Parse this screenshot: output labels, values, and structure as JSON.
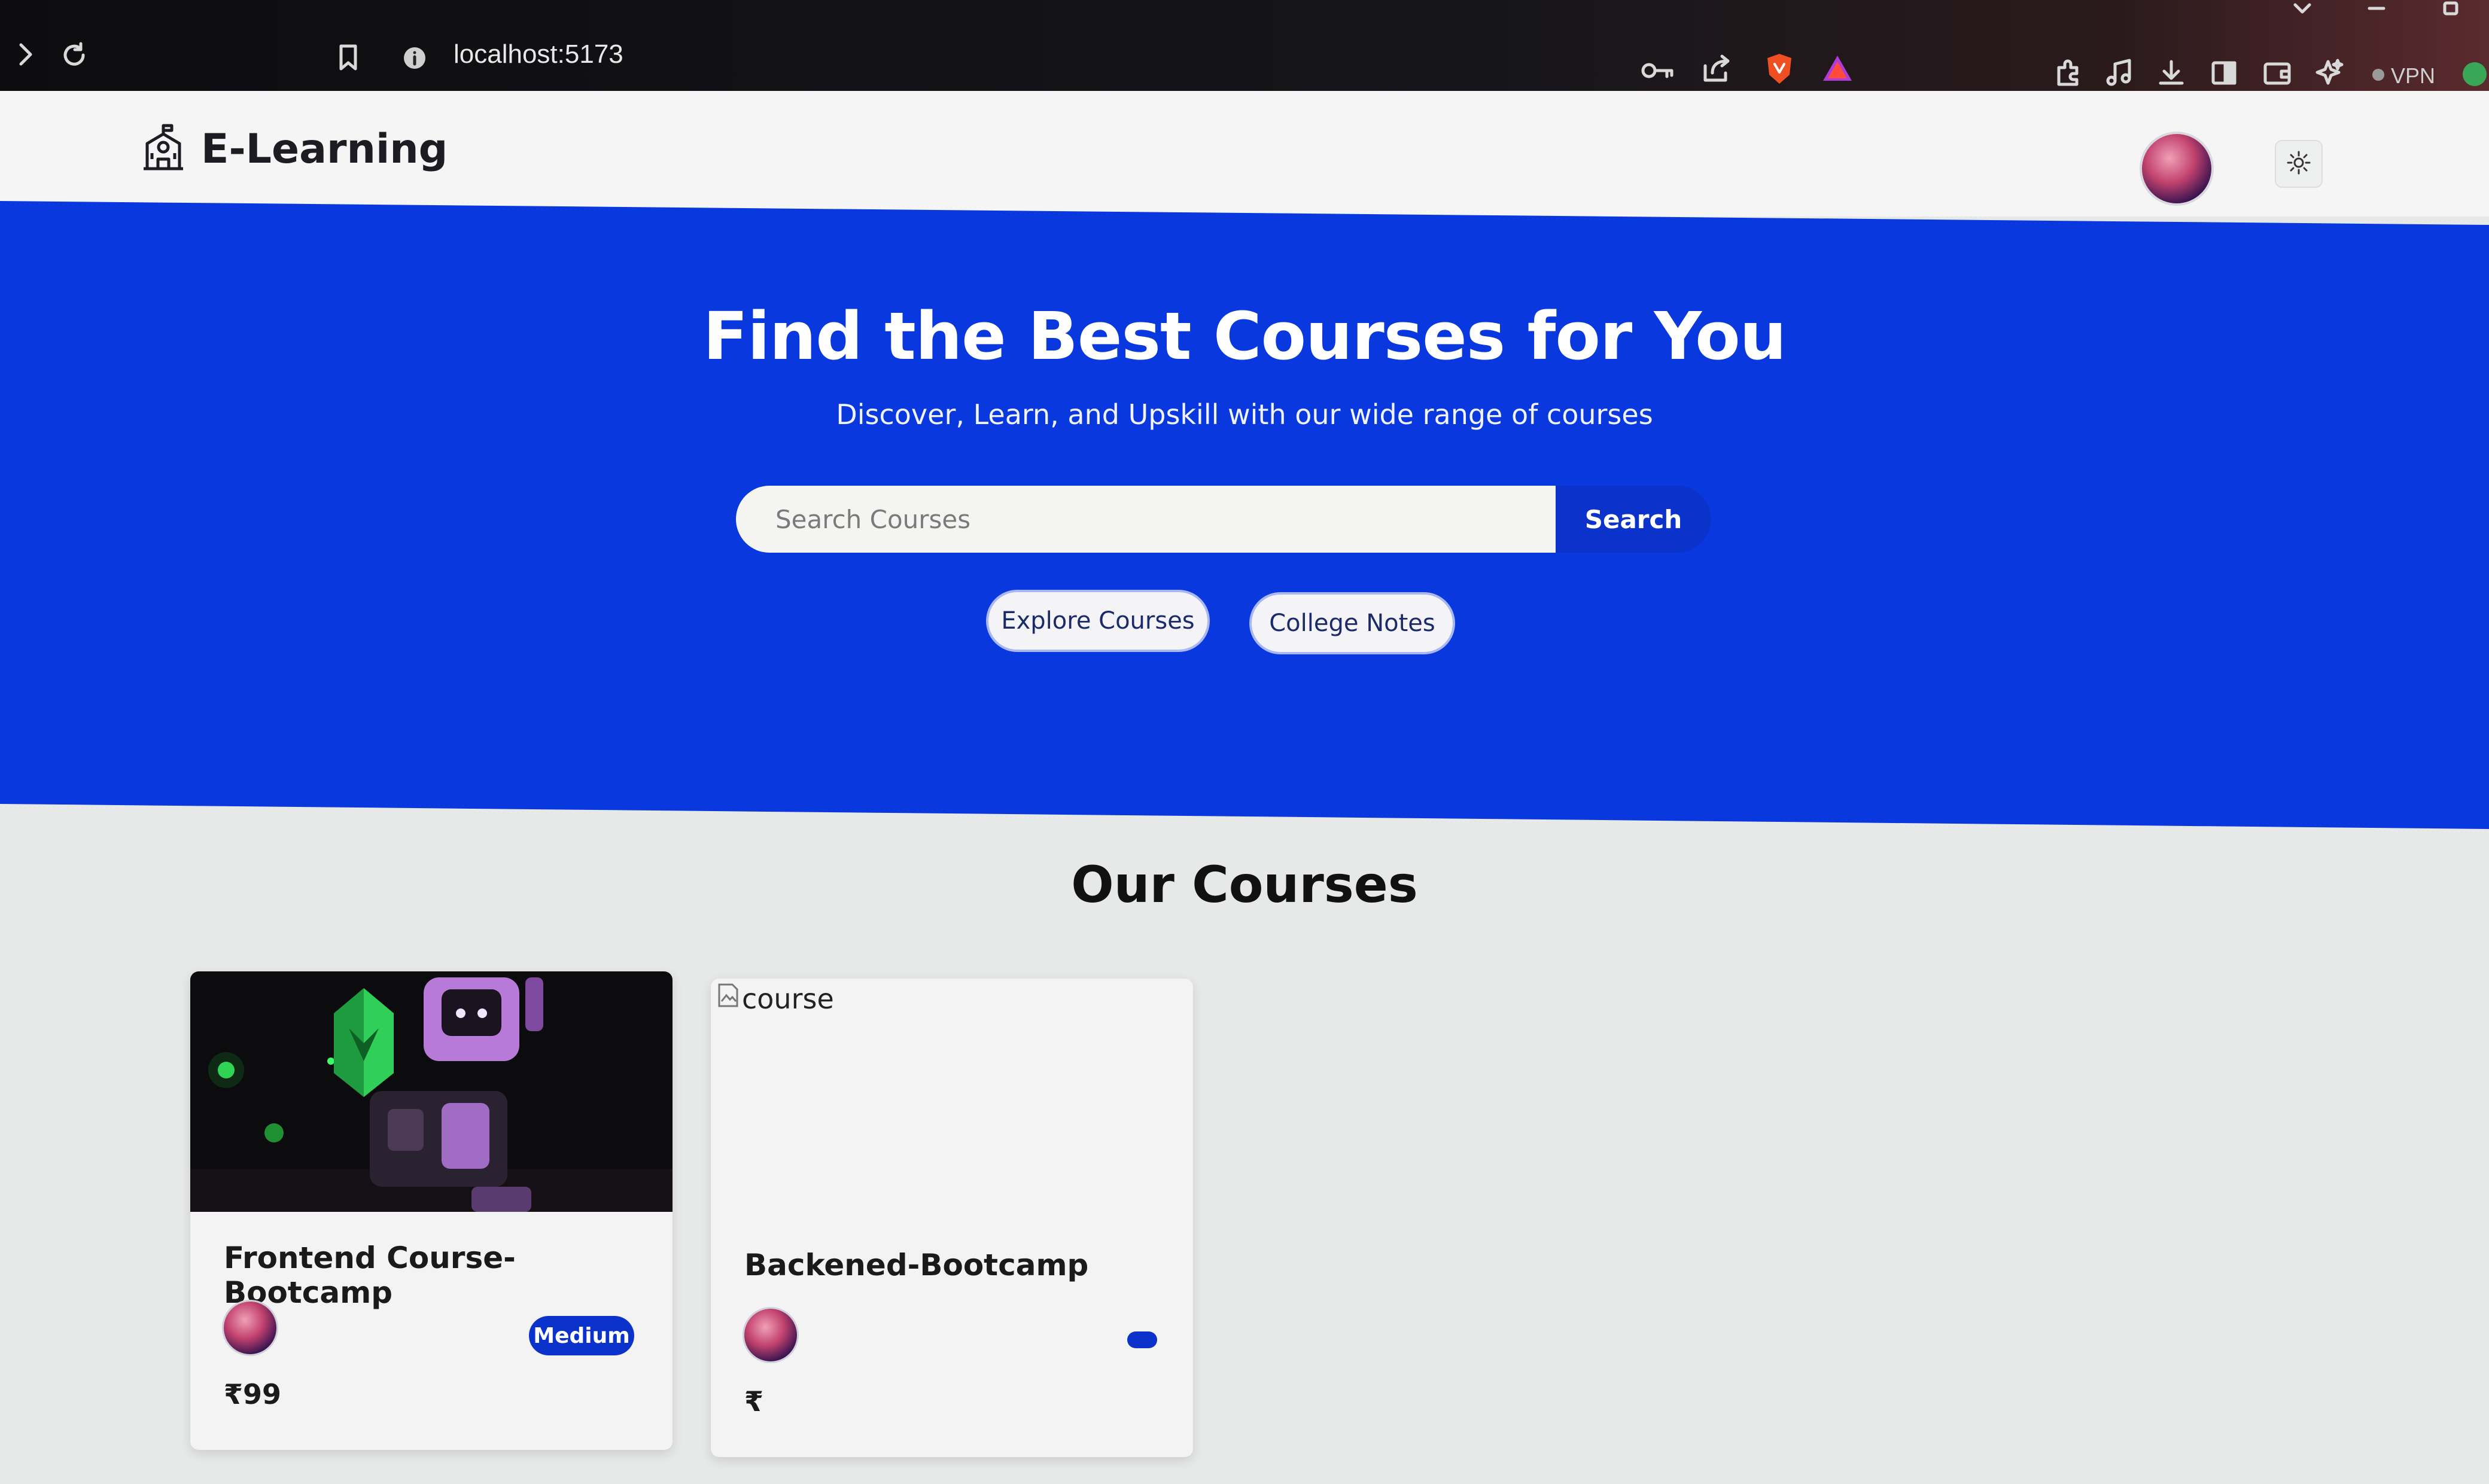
{
  "browser": {
    "url": "localhost:5173",
    "vpn_label": "VPN",
    "icons": [
      "forward-icon",
      "reload-icon",
      "bookmark-icon",
      "site-info-icon",
      "key-icon",
      "share-icon",
      "brave-shield-icon",
      "brave-rewards-icon",
      "extensions-icon",
      "media-icon",
      "download-icon",
      "sidebar-icon",
      "wallet-icon",
      "leo-ai-icon",
      "vpn-icon",
      "chevron-down-icon",
      "minimize-icon",
      "restore-icon"
    ]
  },
  "nav": {
    "brand": "E-Learning",
    "brand_icon": "school-icon",
    "theme_icon": "sun-icon"
  },
  "hero": {
    "title": "Find the Best Courses for You",
    "subtitle": "Discover, Learn, and Upskill with our wide range of courses",
    "search_placeholder": "Search Courses",
    "search_button": "Search",
    "buttons": [
      "Explore Courses",
      "College Notes"
    ],
    "bg_color": "#0939de"
  },
  "courses": {
    "section_title": "Our Courses",
    "items": [
      {
        "title": "Frontend Course-Bootcamp",
        "level": "Medium",
        "price": "₹99",
        "image": "robot-thumbnail"
      },
      {
        "title": "Backened-Bootcamp",
        "level": "",
        "price": "₹",
        "image_alt": "course"
      }
    ]
  },
  "colors": {
    "accent": "#0b33cc",
    "page_bg": "#e7e9e8"
  }
}
